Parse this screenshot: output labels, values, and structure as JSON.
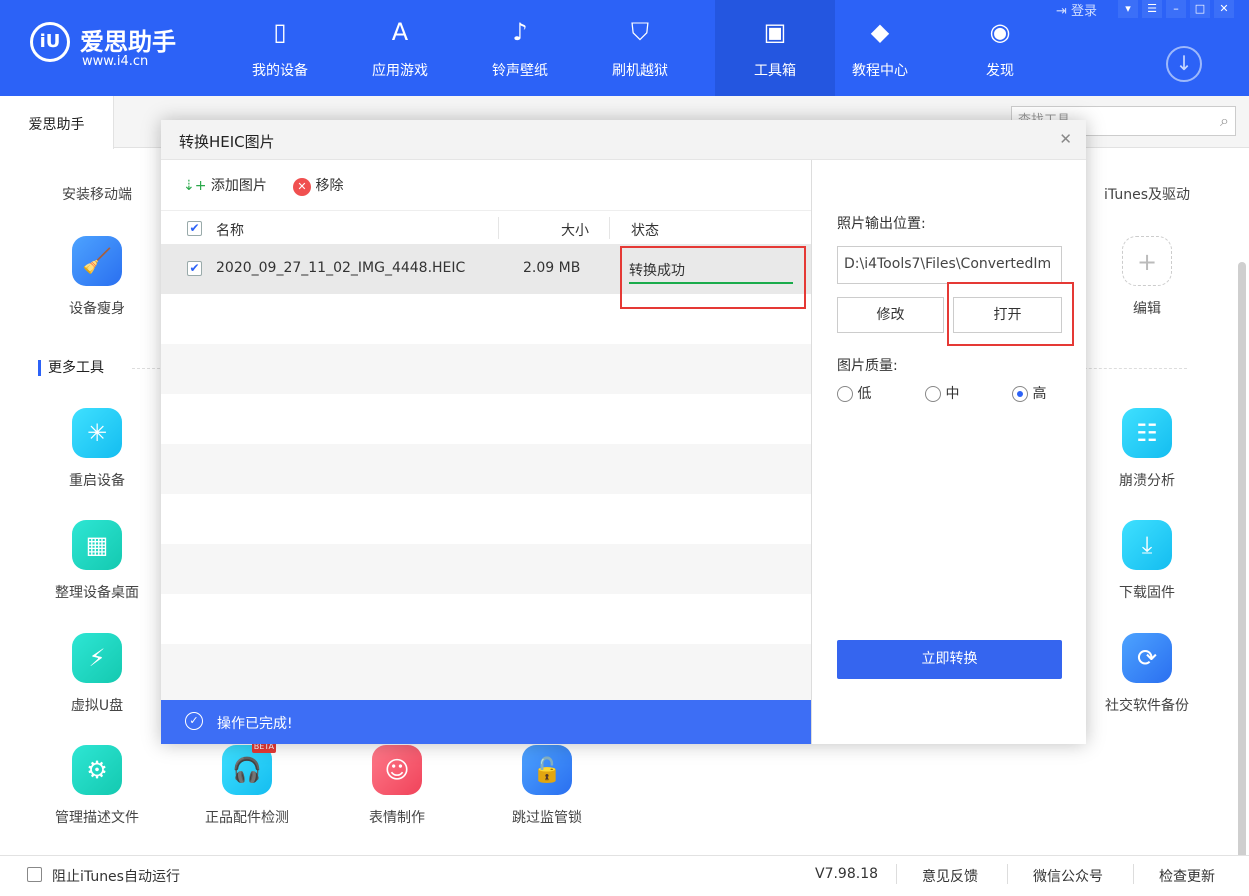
{
  "app": {
    "logo_text": "iU",
    "name": "爱思助手",
    "url": "www.i4.cn",
    "login": "登录"
  },
  "nav": [
    {
      "label": "我的设备",
      "icon": "phone-icon"
    },
    {
      "label": "应用游戏",
      "icon": "appstore-icon"
    },
    {
      "label": "铃声壁纸",
      "icon": "music-icon"
    },
    {
      "label": "刷机越狱",
      "icon": "shield-icon"
    },
    {
      "label": "工具箱",
      "icon": "toolbox-icon"
    },
    {
      "label": "教程中心",
      "icon": "graduation-cap-icon"
    },
    {
      "label": "发现",
      "icon": "compass-icon"
    }
  ],
  "active_nav": "工具箱",
  "tab": "爱思助手",
  "search": {
    "placeholder": "查找工具"
  },
  "tools_left": [
    "安装移动端",
    "设备瘦身",
    "重启设备",
    "整理设备桌面",
    "虚拟U盘",
    "管理描述文件"
  ],
  "tools_right": [
    "iTunes及驱动",
    "编辑",
    "崩溃分析",
    "下载固件",
    "社交软件备份"
  ],
  "tools_bottom": [
    "正品配件检测",
    "表情制作",
    "跳过监管锁"
  ],
  "beta": "BETA",
  "section_more": "更多工具",
  "dialog": {
    "title": "转换HEIC图片",
    "add": "添加图片",
    "remove": "移除",
    "columns": {
      "name": "名称",
      "size": "大小",
      "status": "状态"
    },
    "rows": [
      {
        "name": "2020_09_27_11_02_IMG_4448.HEIC",
        "size": "2.09 MB",
        "status": "转换成功",
        "progress": 100,
        "checked": true
      }
    ],
    "status_message": "操作已完成!",
    "output_label": "照片输出位置:",
    "output_path": "D:\\i4Tools7\\Files\\ConvertedIm",
    "modify": "修改",
    "open": "打开",
    "quality_label": "图片质量:",
    "quality_options": [
      "低",
      "中",
      "高"
    ],
    "quality_selected": "高",
    "convert": "立即转换"
  },
  "footer": {
    "itunes": "阻止iTunes自动运行",
    "version": "V7.98.18",
    "feedback": "意见反馈",
    "wechat": "微信公众号",
    "update": "检查更新"
  },
  "colors": {
    "brand": "#2c62f7",
    "success": "#1aab4b",
    "highlight": "#e53935"
  }
}
